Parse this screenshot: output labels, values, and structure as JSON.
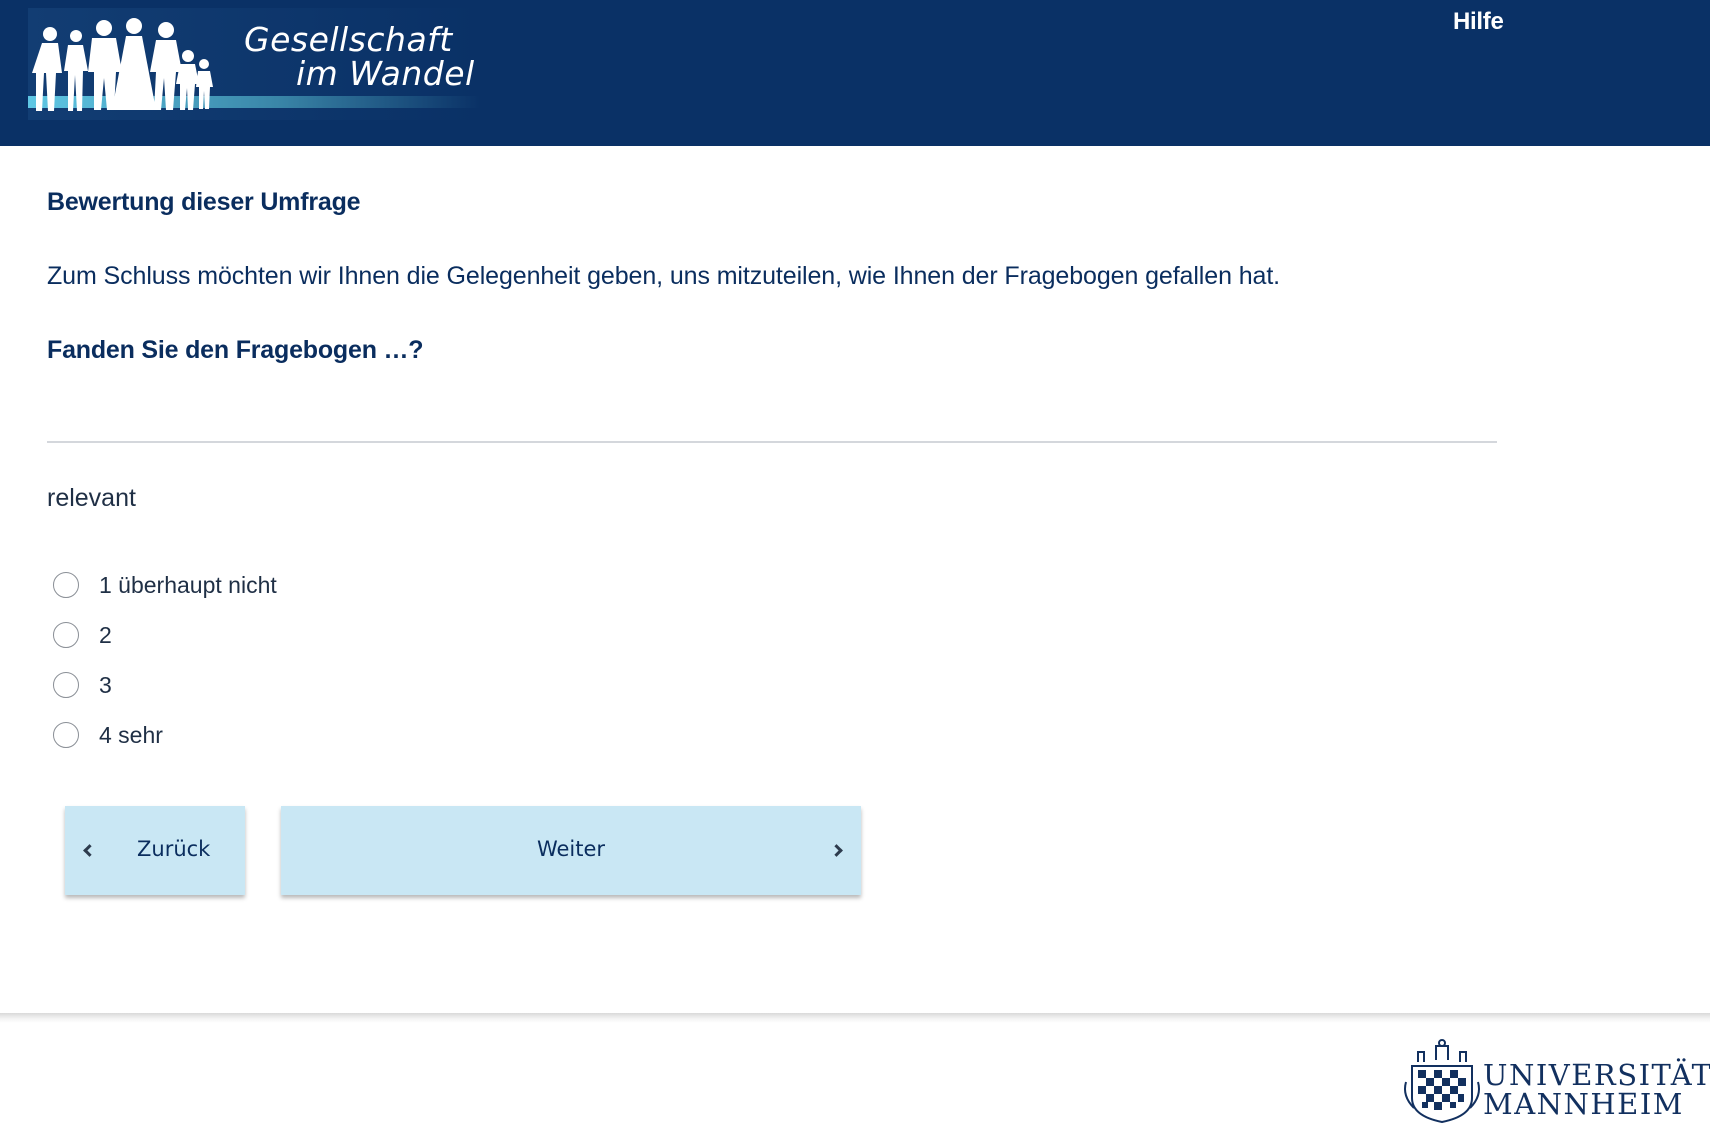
{
  "header": {
    "logo_line1": "Gesellschaft",
    "logo_line2": "im Wandel",
    "help_link": "Hilfe"
  },
  "survey": {
    "section_title": "Bewertung dieser Umfrage",
    "intro": "Zum Schluss möchten wir Ihnen die Gelegenheit geben, uns mitzuteilen, wie Ihnen der Fragebogen gefallen hat.",
    "question": "Fanden Sie den Fragebogen …?",
    "item_label": "relevant",
    "options": [
      {
        "label": "1 überhaupt nicht",
        "selected": false
      },
      {
        "label": "2",
        "selected": false
      },
      {
        "label": "3",
        "selected": false
      },
      {
        "label": "4 sehr",
        "selected": false
      }
    ]
  },
  "navigation": {
    "back_label": "Zurück",
    "next_label": "Weiter",
    "back_icon": "chevron-left-icon",
    "next_icon": "chevron-right-icon"
  },
  "footer": {
    "university_line1": "UNIVERSITÄT",
    "university_line2": "MANNHEIM"
  },
  "colors": {
    "header_bg": "#0a3166",
    "text_primary": "#0a2d5e",
    "button_bg": "#c9e7f4"
  }
}
